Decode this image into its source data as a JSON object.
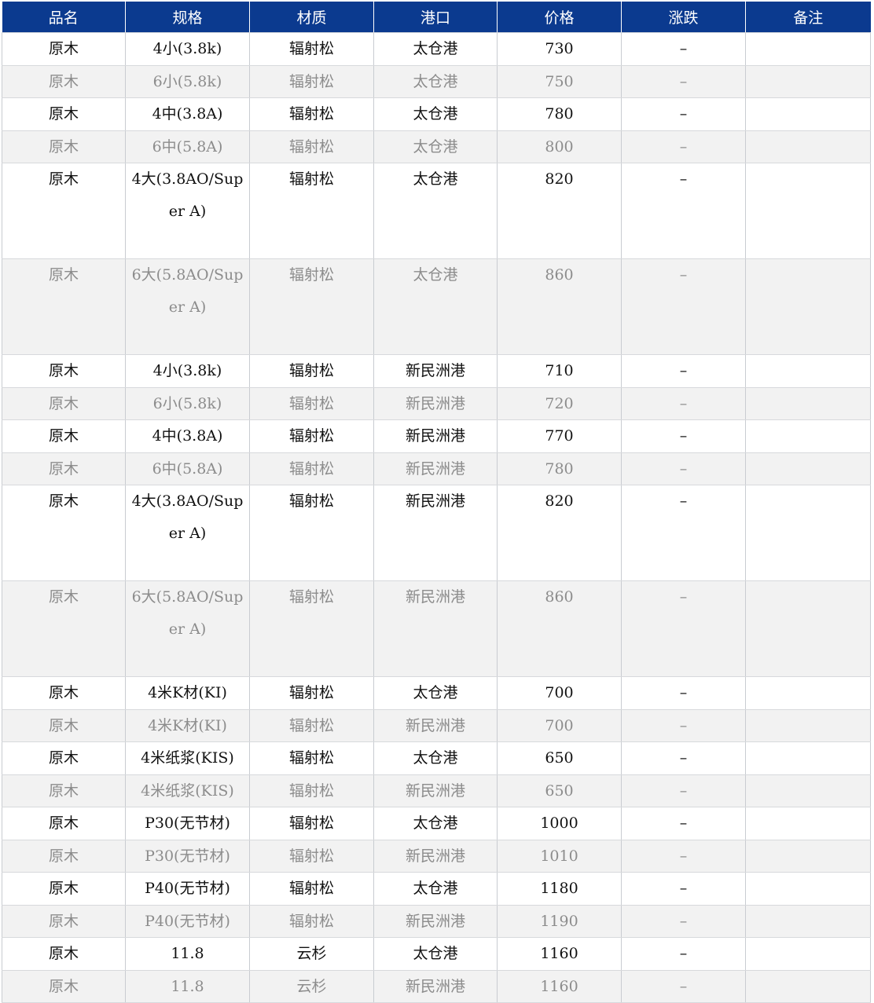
{
  "table": {
    "headers": [
      "品名",
      "规格",
      "材质",
      "港口",
      "价格",
      "涨跌",
      "备注"
    ],
    "rows": [
      [
        "原木",
        "4小(3.8k)",
        "辐射松",
        "太仓港",
        "730",
        "–",
        ""
      ],
      [
        "原木",
        "6小(5.8k)",
        "辐射松",
        "太仓港",
        "750",
        "–",
        ""
      ],
      [
        "原木",
        "4中(3.8A)",
        "辐射松",
        "太仓港",
        "780",
        "–",
        ""
      ],
      [
        "原木",
        "6中(5.8A)",
        "辐射松",
        "太仓港",
        "800",
        "–",
        ""
      ],
      [
        "原木",
        "4大(3.8AO/Super A)",
        "辐射松",
        "太仓港",
        "820",
        "–",
        ""
      ],
      [
        "原木",
        "6大(5.8AO/Super A)",
        "辐射松",
        "太仓港",
        "860",
        "–",
        ""
      ],
      [
        "原木",
        "4小(3.8k)",
        "辐射松",
        "新民洲港",
        "710",
        "–",
        ""
      ],
      [
        "原木",
        "6小(5.8k)",
        "辐射松",
        "新民洲港",
        "720",
        "–",
        ""
      ],
      [
        "原木",
        "4中(3.8A)",
        "辐射松",
        "新民洲港",
        "770",
        "–",
        ""
      ],
      [
        "原木",
        "6中(5.8A)",
        "辐射松",
        "新民洲港",
        "780",
        "–",
        ""
      ],
      [
        "原木",
        "4大(3.8AO/Super A)",
        "辐射松",
        "新民洲港",
        "820",
        "–",
        ""
      ],
      [
        "原木",
        "6大(5.8AO/Super A)",
        "辐射松",
        "新民洲港",
        "860",
        "–",
        ""
      ],
      [
        "原木",
        "4米K材(KI)",
        "辐射松",
        "太仓港",
        "700",
        "–",
        ""
      ],
      [
        "原木",
        "4米K材(KI)",
        "辐射松",
        "新民洲港",
        "700",
        "–",
        ""
      ],
      [
        "原木",
        "4米纸浆(KIS)",
        "辐射松",
        "太仓港",
        "650",
        "–",
        ""
      ],
      [
        "原木",
        "4米纸浆(KIS)",
        "辐射松",
        "新民洲港",
        "650",
        "–",
        ""
      ],
      [
        "原木",
        "P30(无节材)",
        "辐射松",
        "太仓港",
        "1000",
        "–",
        ""
      ],
      [
        "原木",
        "P30(无节材)",
        "辐射松",
        "新民洲港",
        "1010",
        "–",
        ""
      ],
      [
        "原木",
        "P40(无节材)",
        "辐射松",
        "太仓港",
        "1180",
        "–",
        ""
      ],
      [
        "原木",
        "P40(无节材)",
        "辐射松",
        "新民洲港",
        "1190",
        "–",
        ""
      ],
      [
        "原木",
        "11.8",
        "云杉",
        "太仓港",
        "1160",
        "–",
        ""
      ],
      [
        "原木",
        "11.8",
        "云杉",
        "新民洲港",
        "1160",
        "–",
        ""
      ]
    ]
  }
}
